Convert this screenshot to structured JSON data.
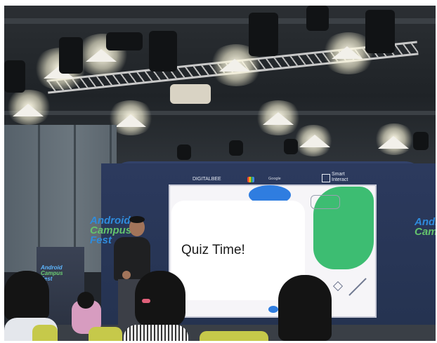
{
  "scene": {
    "screen_text": "Quiz Time!",
    "stage_logos": [
      "DIGITALBEE",
      "Google",
      "Smart\nInteract"
    ],
    "stage_logo_labels": {
      "left": "DIGITALBEE",
      "middle": "Google",
      "right_line1": "Smart",
      "right_line2": "Interact"
    },
    "side_brand_left": {
      "line1": "Android",
      "line2": "Campus",
      "line3": "Fest"
    },
    "side_brand_right": {
      "line1": "Andr",
      "line2": "Camp"
    },
    "kiosk_brand": {
      "line1": "Android",
      "line2": "Campus",
      "line3": "Fest"
    }
  },
  "colors": {
    "stage_wall": "#2c3a5e",
    "screen_green": "#3dbd72",
    "screen_blue": "#2f7de0",
    "chair_yellow": "#c6c94a"
  }
}
